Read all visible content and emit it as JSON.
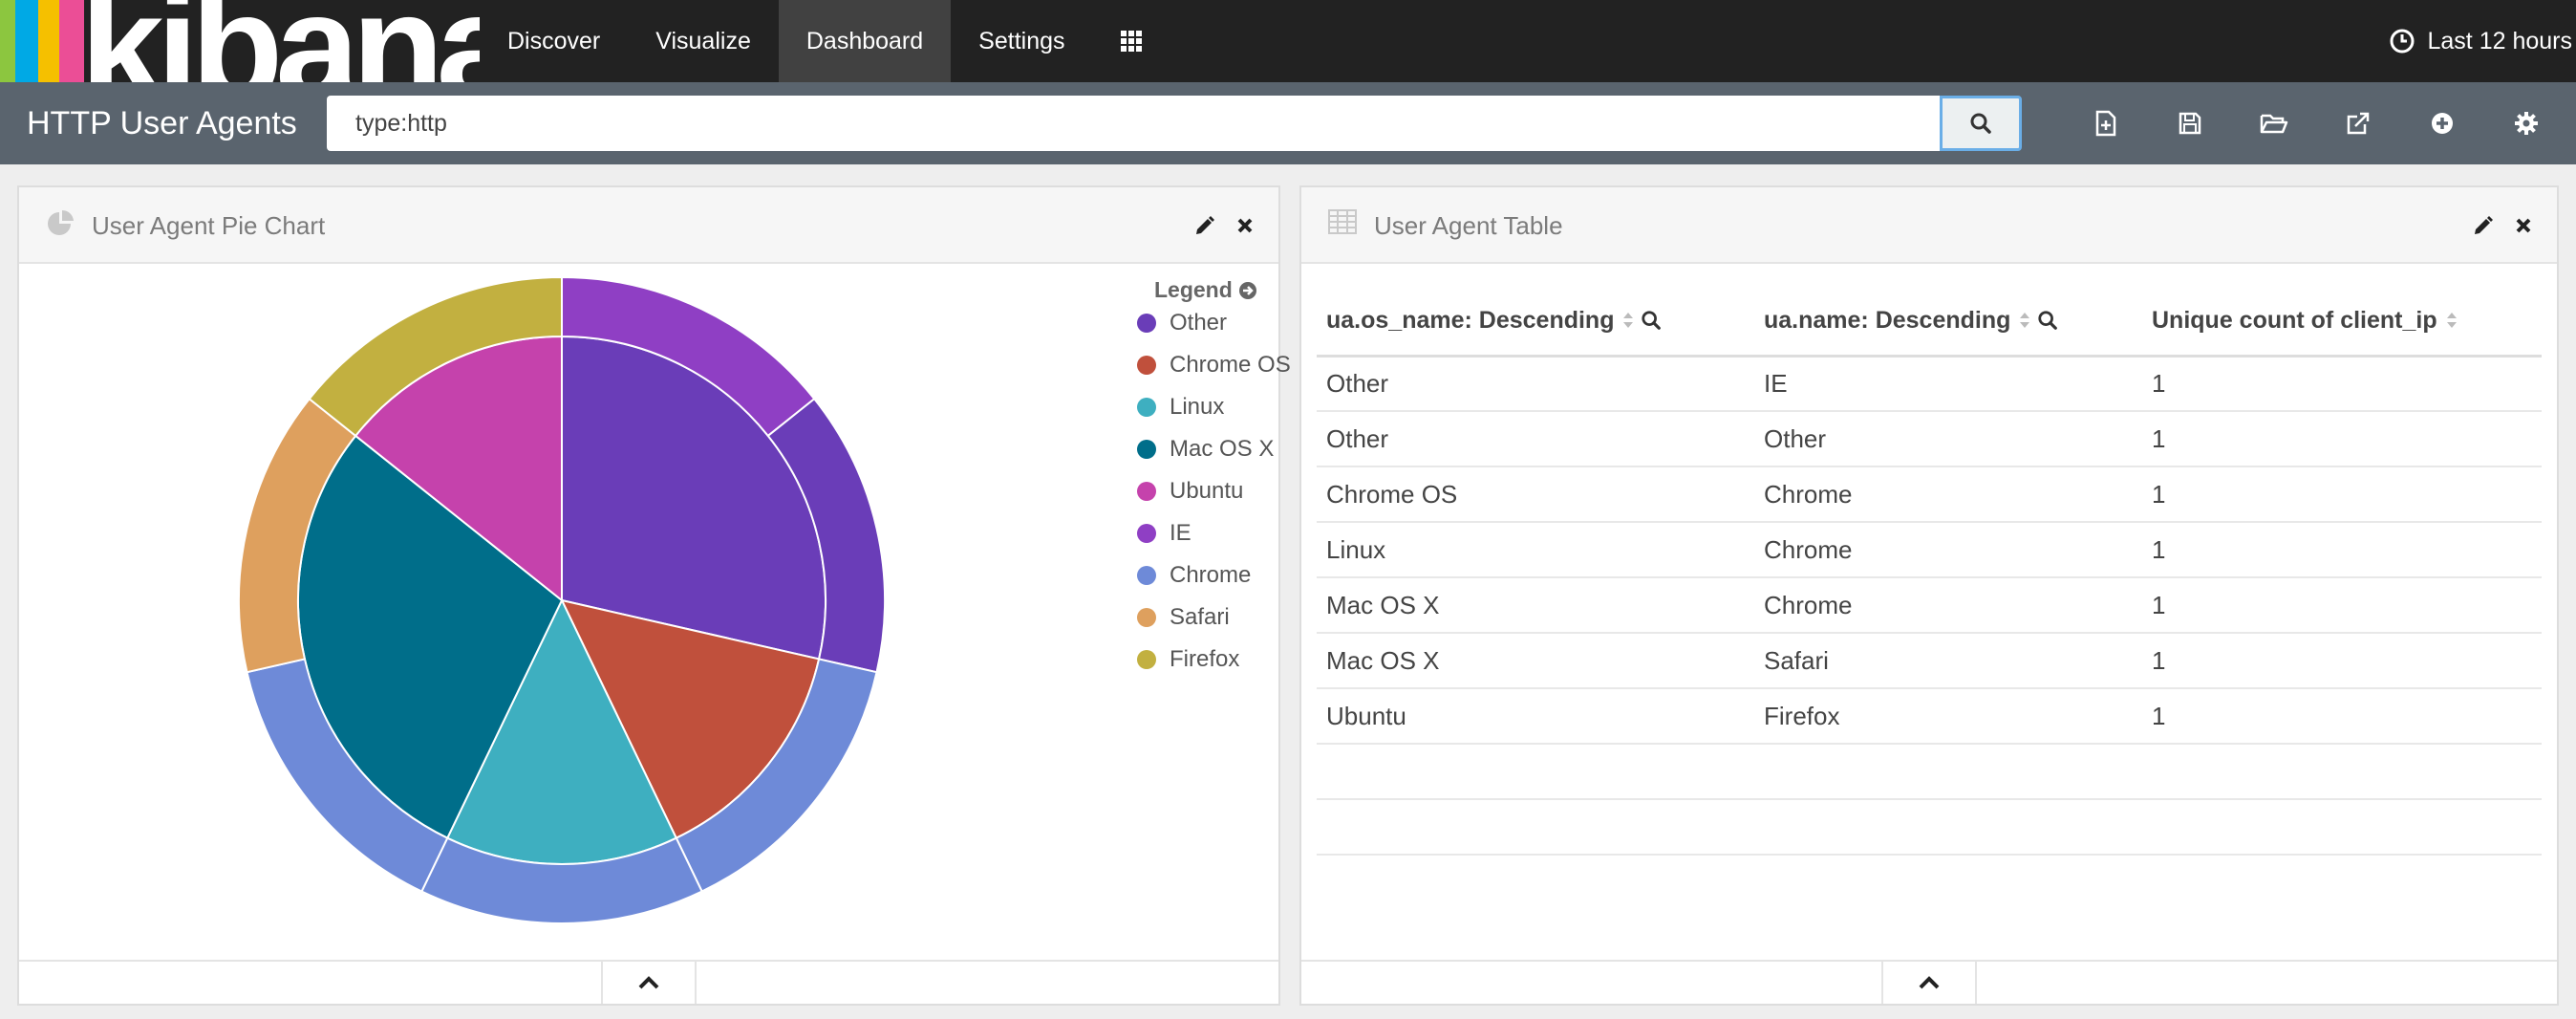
{
  "nav": {
    "logo_text": "kibana",
    "logo_colors": [
      "#8cc63f",
      "#00a9e5",
      "#f5c000",
      "#eb4e96"
    ],
    "items": [
      {
        "label": "Discover"
      },
      {
        "label": "Visualize"
      },
      {
        "label": "Dashboard",
        "active": true
      },
      {
        "label": "Settings"
      }
    ],
    "apps_icon": "grid-icon",
    "timepicker": {
      "icon": "clock-icon",
      "label": "Last 12 hours"
    }
  },
  "subnav": {
    "dashboard_title": "HTTP User Agents",
    "query_value": "type:http",
    "search_icon": "search-icon",
    "toolbar_icons": [
      "new-dashboard-icon",
      "save-icon",
      "open-folder-icon",
      "share-icon",
      "add-panel-icon",
      "settings-gear-icon"
    ]
  },
  "pie_panel": {
    "title": "User Agent Pie Chart",
    "icon": "pie-chart-icon",
    "actions": [
      "edit-pencil-icon",
      "close-icon"
    ],
    "legend_title": "Legend",
    "legend": [
      {
        "label": "Other",
        "color": "#6a3db8"
      },
      {
        "label": "Chrome OS",
        "color": "#c0503c"
      },
      {
        "label": "Linux",
        "color": "#3eafc0"
      },
      {
        "label": "Mac OS X",
        "color": "#006e8a"
      },
      {
        "label": "Ubuntu",
        "color": "#c542ac"
      },
      {
        "label": "IE",
        "color": "#8f3fc4"
      },
      {
        "label": "Chrome",
        "color": "#6e8ad8"
      },
      {
        "label": "Safari",
        "color": "#dea05e"
      },
      {
        "label": "Firefox",
        "color": "#c2b040"
      }
    ]
  },
  "table_panel": {
    "title": "User Agent Table",
    "icon": "table-icon",
    "actions": [
      "edit-pencil-icon",
      "close-icon"
    ],
    "columns": [
      {
        "label": "ua.os_name: Descending",
        "searchable": true
      },
      {
        "label": "ua.name: Descending",
        "searchable": true
      },
      {
        "label": "Unique count of client_ip",
        "searchable": false
      }
    ],
    "rows": [
      [
        "Other",
        "IE",
        "1"
      ],
      [
        "Other",
        "Other",
        "1"
      ],
      [
        "Chrome OS",
        "Chrome",
        "1"
      ],
      [
        "Linux",
        "Chrome",
        "1"
      ],
      [
        "Mac OS X",
        "Chrome",
        "1"
      ],
      [
        "Mac OS X",
        "Safari",
        "1"
      ],
      [
        "Ubuntu",
        "Firefox",
        "1"
      ]
    ]
  },
  "chart_data": {
    "type": "pie",
    "rings": [
      {
        "name": "",
        "slices": [
          {
            "label": "Other",
            "value": 2,
            "color": "#6a3db8"
          },
          {
            "label": "Chrome OS",
            "value": 1,
            "color": "#c0503c"
          },
          {
            "label": "Linux",
            "value": 1,
            "color": "#3eafc0"
          },
          {
            "label": "Mac OS X",
            "value": 2,
            "color": "#006e8a"
          },
          {
            "label": "Ubuntu",
            "value": 1,
            "color": "#c542ac"
          }
        ]
      },
      {
        "name": "",
        "slices": [
          {
            "label": "IE",
            "parent": "Other",
            "value": 1,
            "color": "#8f3fc4"
          },
          {
            "label": "Other",
            "parent": "Other",
            "value": 1,
            "color": "#6a3db8"
          },
          {
            "label": "Chrome",
            "parent": "Chrome OS",
            "value": 1,
            "color": "#6e8ad8"
          },
          {
            "label": "Chrome",
            "parent": "Linux",
            "value": 1,
            "color": "#6e8ad8"
          },
          {
            "label": "Chrome",
            "parent": "Mac OS X",
            "value": 1,
            "color": "#6e8ad8"
          },
          {
            "label": "Safari",
            "parent": "Mac OS X",
            "value": 1,
            "color": "#dea05e"
          },
          {
            "label": "Firefox",
            "parent": "Ubuntu",
            "value": 1,
            "color": "#c2b040"
          }
        ]
      }
    ]
  }
}
